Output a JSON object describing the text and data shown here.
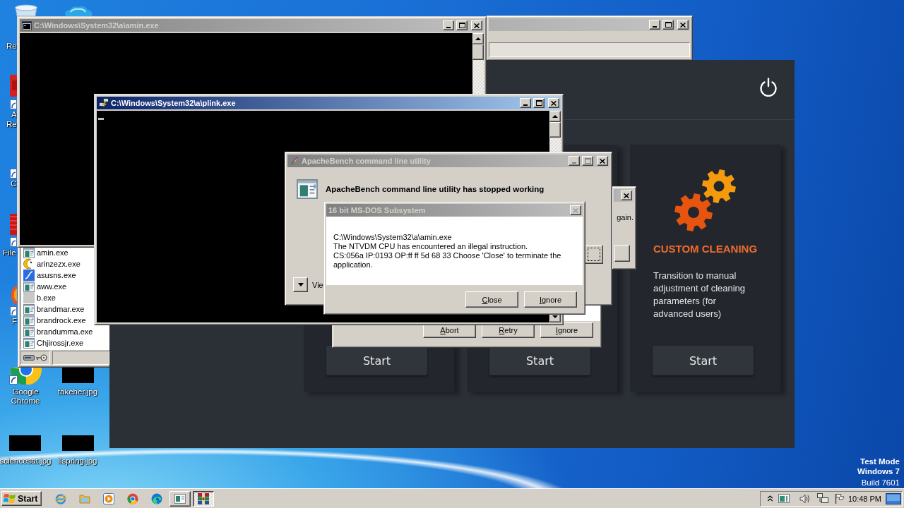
{
  "desktop": {
    "icons": [
      {
        "kind": "bin",
        "lines": [
          "Re"
        ]
      },
      {
        "kind": "cloud"
      },
      {
        "kind": "document",
        "lines": [
          "A",
          "Re"
        ]
      },
      {
        "kind": "shortcut",
        "lines": [
          "C"
        ]
      },
      {
        "kind": "app_square",
        "lines": [
          "File"
        ]
      },
      {
        "kind": "app_round",
        "lines": [
          "F"
        ]
      },
      {
        "kind": "browser_logo",
        "lines": [
          "Google",
          "Chrome"
        ]
      },
      {
        "kind": "thumbnail",
        "lines": [
          "takeher.jpg"
        ]
      },
      {
        "kind": "thumbnail",
        "lines": [
          "sciencesat.jpg"
        ]
      },
      {
        "kind": "thumbnail",
        "lines": [
          "ilspring.jpg"
        ]
      }
    ],
    "notice": [
      "Test Mode",
      "Windows 7",
      "Build 7601"
    ]
  },
  "file_list_window": {
    "items": [
      {
        "kind": "program",
        "name": "amin.exe"
      },
      {
        "kind": "crescent",
        "name": "arinzezx.exe"
      },
      {
        "kind": "curve",
        "name": "asusns.exe"
      },
      {
        "kind": "program",
        "name": "aww.exe"
      },
      {
        "kind": "blank",
        "name": "b.exe"
      },
      {
        "kind": "program",
        "name": "brandmar.exe"
      },
      {
        "kind": "program",
        "name": "brandrock.exe"
      },
      {
        "kind": "program",
        "name": "brandumma.exe"
      },
      {
        "kind": "program",
        "name": "Chjirossjr.exe"
      }
    ]
  },
  "back_window": {
    "active": false
  },
  "cleaner_app": {
    "cards": [
      {
        "button": "Start"
      },
      {
        "button": "Start"
      },
      {
        "title": "CUSTOM CLEANING",
        "description": "Transition to manual adjustment of cleaning parameters (for advanced users)",
        "button": "Start"
      }
    ]
  },
  "message_box": {
    "active": false,
    "text": "gain."
  },
  "abort_dialog": {
    "buttons": [
      "Abort",
      "Retry",
      "Ignore"
    ]
  },
  "amin_console": {
    "title": "C:\\Windows\\System32\\a\\amin.exe",
    "active": false
  },
  "plink_console": {
    "title": "C:\\Windows\\System32\\a\\plink.exe",
    "active": true,
    "cursor": true
  },
  "error_dialog": {
    "title": "ApacheBench command line utility",
    "active": false,
    "heading": "ApacheBench command line utility has stopped working",
    "details": "Vie"
  },
  "ntvdm_dialog": {
    "title": "16 bit MS-DOS Subsystem",
    "active": false,
    "message": [
      "C:\\Windows\\System32\\a\\amin.exe",
      "The NTVDM CPU has encountered an illegal instruction.",
      "CS:056a IP:0193 OP:ff ff 5d 68 33 Choose 'Close' to terminate the application."
    ],
    "buttons": [
      "Close",
      "Ignore"
    ]
  },
  "taskbar": {
    "start": "Start",
    "tasks": [
      {
        "kind": "console",
        "selected": false
      },
      {
        "kind": "archive",
        "selected": true
      }
    ],
    "clock": "10:48 PM"
  }
}
